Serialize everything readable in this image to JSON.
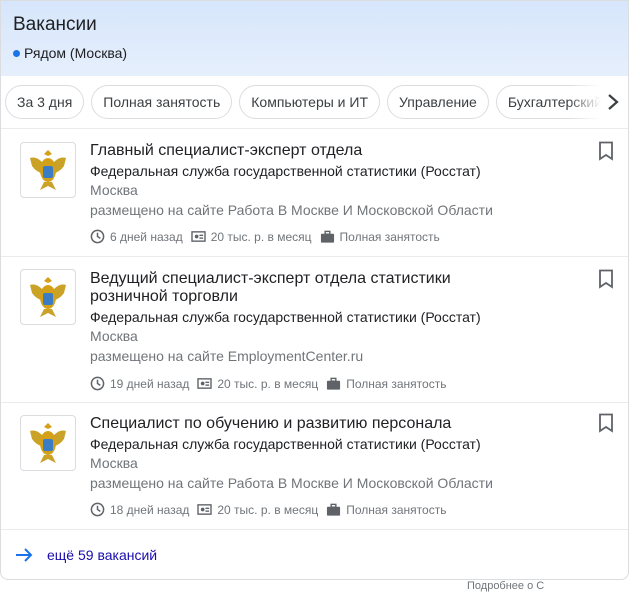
{
  "header": {
    "title": "Вакансии",
    "location": "Рядом (Москва)"
  },
  "chips": [
    "За 3 дня",
    "Полная занятость",
    "Компьютеры и ИТ",
    "Управление",
    "Бухгалтерский учёт"
  ],
  "jobs": [
    {
      "title_lines": [
        "Главный специалист-эксперт отдела"
      ],
      "org": "Федеральная служба государственной статистики (Росстат)",
      "city": "Москва",
      "via": "размещено на сайте Работа В Москве И Московской Области",
      "posted": "6 дней назад",
      "salary": "20 тыс. р. в месяц",
      "type": "Полная занятость"
    },
    {
      "title_lines": [
        "Ведущий специалист-эксперт отдела статистики",
        "розничной торговли"
      ],
      "org": "Федеральная служба государственной статистики (Росстат)",
      "city": "Москва",
      "via": "размещено на сайте EmploymentCenter.ru",
      "posted": "19 дней назад",
      "salary": "20 тыс. р. в месяц",
      "type": "Полная занятость"
    },
    {
      "title_lines": [
        "Специалист по обучению и развитию персонала"
      ],
      "org": "Федеральная служба государственной статистики (Росстат)",
      "city": "Москва",
      "via": "размещено на сайте Работа В Москве И Московской Области",
      "posted": "18 дней назад",
      "salary": "20 тыс. р. в месяц",
      "type": "Полная занятость"
    }
  ],
  "more_link": "ещё 59 вакансий",
  "footer": "Подробнее о С",
  "icons": {
    "chips_next": "chevron-right-icon",
    "bookmark": "bookmark-icon",
    "posted": "clock-icon",
    "salary": "banknote-icon",
    "type": "briefcase-icon",
    "more": "arrow-right-icon",
    "logo": "rosstat-emblem-icon"
  },
  "colors": {
    "header_bg": "#d6e6fb",
    "location_dot": "#1a73e8",
    "link": "#1a0dab",
    "muted": "#70757a"
  }
}
